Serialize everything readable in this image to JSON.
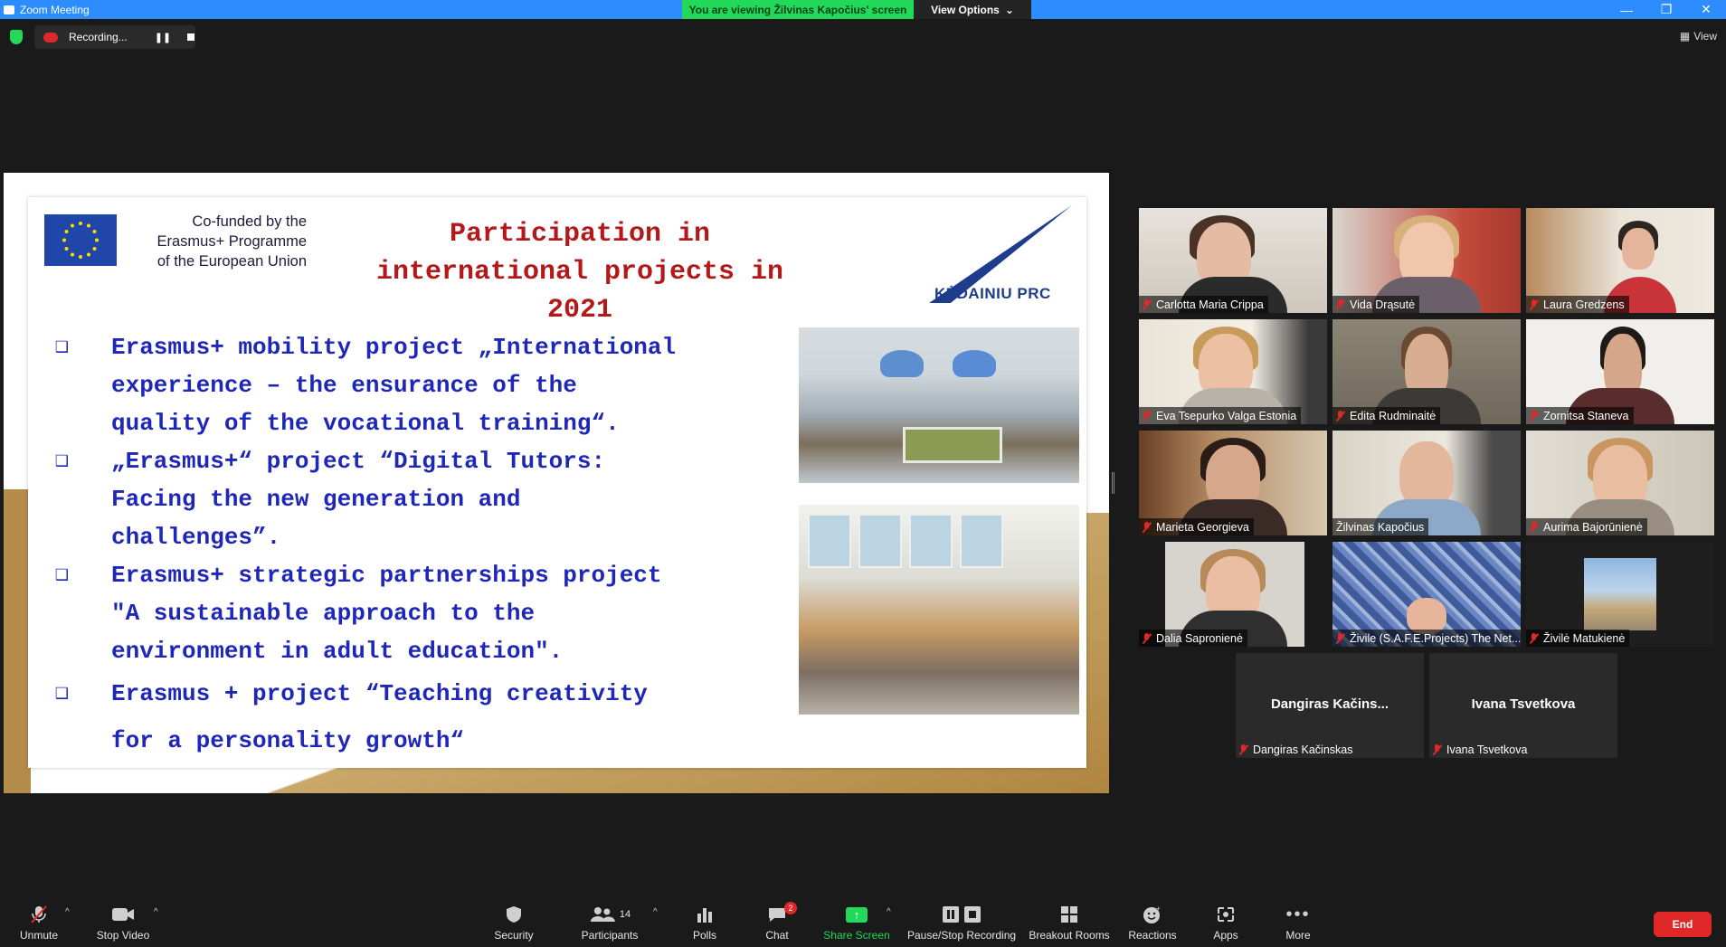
{
  "window": {
    "title": "Zoom Meeting",
    "viewing_banner": "You are viewing Žilvinas Kapočius' screen",
    "view_options": "View Options",
    "view_toggle": "View"
  },
  "recording": {
    "status": "Recording..."
  },
  "slide": {
    "eu_line1": "Co-funded by the",
    "eu_line2": "Erasmus+ Programme",
    "eu_line3": "of the European Union",
    "title_line1": "Participation in",
    "title_line2": "international projects in",
    "title_line3": "2021",
    "logo_text": "KĖDAINIU PRC",
    "bullets": [
      {
        "lines": [
          "Erasmus+ mobility project „International",
          "experience – the ensurance of the",
          "quality of the vocational training“."
        ]
      },
      {
        "lines": [
          "„Erasmus+“ project “Digital Tutors:",
          "Facing the new generation and",
          "challenges”."
        ]
      },
      {
        "lines": [
          "Erasmus+ strategic partnerships project",
          "\"A sustainable approach to the",
          "environment in adult education\"."
        ]
      },
      {
        "lines": [
          "Erasmus + project “Teaching creativity",
          "for a personality growth“"
        ]
      }
    ]
  },
  "participants": [
    {
      "name": "Carlotta Maria Crippa"
    },
    {
      "name": "Vida Drąsutė"
    },
    {
      "name": "Laura Gredzens"
    },
    {
      "name": "Eva Tsepurko Valga Estonia"
    },
    {
      "name": "Edita Rudminaitė"
    },
    {
      "name": "Zornitsa Staneva"
    },
    {
      "name": "Marieta Georgieva"
    },
    {
      "name": "Žilvinas Kapočius"
    },
    {
      "name": "Aurima Bajorūnienė"
    },
    {
      "name": "Dalia Sapronienė"
    },
    {
      "name": "Živile (S.A.F.E.Projects) The Net..."
    },
    {
      "name": "Živilė Matukienė"
    },
    {
      "name": "Dangiras Kačinskas",
      "display": "Dangiras  Kačins..."
    },
    {
      "name": "Ivana Tsvetkova",
      "display": "Ivana Tsvetkova"
    }
  ],
  "toolbar": {
    "unmute": "Unmute",
    "stop_video": "Stop Video",
    "security": "Security",
    "participants": "Participants",
    "participant_count": "14",
    "polls": "Polls",
    "chat": "Chat",
    "chat_badge": "2",
    "share_screen": "Share Screen",
    "pause_stop": "Pause/Stop Recording",
    "breakout": "Breakout Rooms",
    "reactions": "Reactions",
    "apps": "Apps",
    "more": "More",
    "end": "End"
  },
  "colors": {
    "zoom_blue": "#2d8cff",
    "banner_green": "#23d959",
    "slide_title_red": "#b41919",
    "slide_text_blue": "#1f27b8",
    "end_red": "#e02828",
    "active_speaker": "#b9e15a"
  }
}
